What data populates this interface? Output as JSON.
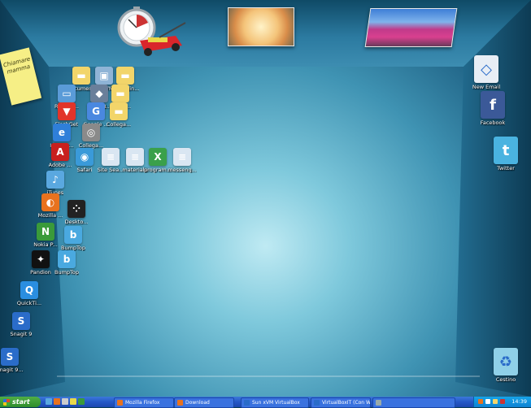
{
  "note": {
    "text": "Chiamare mamma"
  },
  "desktop_icons": [
    {
      "id": "documenti",
      "label": "Documenti",
      "icon": "folder-icon",
      "color": "#f2d56a"
    },
    {
      "id": "sugarvm",
      "label": "SugarVM...",
      "icon": "vm-icon",
      "color": "#8fb4d6"
    },
    {
      "id": "immagini",
      "label": "Immagin...",
      "icon": "folder-icon",
      "color": "#f2d56a"
    },
    {
      "id": "risorse",
      "label": "Risorse...",
      "icon": "computer-icon",
      "color": "#5a9bd8"
    },
    {
      "id": "freedb",
      "label": "FreeDB...",
      "icon": "app-icon",
      "color": "#6a7f9a"
    },
    {
      "id": "collegamento1",
      "label": "Colleg...",
      "icon": "folder-icon",
      "color": "#f2d56a"
    },
    {
      "id": "flashget",
      "label": "FlashGet",
      "icon": "flashget-icon",
      "color": "#e2342a"
    },
    {
      "id": "google",
      "label": "Google ...",
      "icon": "google-icon",
      "color": "#4a88e0"
    },
    {
      "id": "collegamento2",
      "label": "Collega...",
      "icon": "folder-icon",
      "color": "#f2d56a"
    },
    {
      "id": "internet",
      "label": "Interne...",
      "icon": "internet-explorer-icon",
      "color": "#2f7fd9"
    },
    {
      "id": "collegamento3",
      "label": "Collega...",
      "icon": "shortcut-icon",
      "color": "#8a8a8a"
    },
    {
      "id": "adobe",
      "label": "Adobe ...",
      "icon": "adobe-reader-icon",
      "color": "#c8201e"
    },
    {
      "id": "safari",
      "label": "Safari",
      "icon": "safari-icon",
      "color": "#3a9ad9"
    },
    {
      "id": "siteseal",
      "label": "Site Sea...",
      "icon": "document-icon",
      "color": "#d9e6f2"
    },
    {
      "id": "materiale",
      "label": "materiale",
      "icon": "document-icon",
      "color": "#d9e6f2"
    },
    {
      "id": "programma",
      "label": "program...",
      "icon": "excel-icon",
      "color": "#3aa04a"
    },
    {
      "id": "messenger",
      "label": "messeng...",
      "icon": "document-icon",
      "color": "#d9e6f2"
    },
    {
      "id": "itunes",
      "label": "iTunes",
      "icon": "itunes-icon",
      "color": "#5aa8e0"
    },
    {
      "id": "mozilla",
      "label": "Mozilla ...",
      "icon": "firefox-icon",
      "color": "#e8721e"
    },
    {
      "id": "desktop",
      "label": "Deskto...",
      "icon": "blackberry-icon",
      "color": "#222"
    },
    {
      "id": "nokia",
      "label": "Nokia P...",
      "icon": "nokia-icon",
      "color": "#3a9a3a"
    },
    {
      "id": "bumptop1",
      "label": "BumpTop",
      "icon": "bumptop-icon",
      "color": "#4aa9e0"
    },
    {
      "id": "pandion",
      "label": "Pandion",
      "icon": "pandion-icon",
      "color": "#111"
    },
    {
      "id": "bumptop2",
      "label": "BumpTop",
      "icon": "bumptop-icon",
      "color": "#4aa9e0"
    },
    {
      "id": "quicktime",
      "label": "QuickTi...",
      "icon": "quicktime-icon",
      "color": "#2a8ee0"
    },
    {
      "id": "snagit1",
      "label": "Snagit 9",
      "icon": "snagit-icon",
      "color": "#2a6cc9"
    },
    {
      "id": "snagit2",
      "label": "Snagit 9...",
      "icon": "snagit-icon",
      "color": "#2a6cc9"
    }
  ],
  "right_icons": [
    {
      "id": "newemail",
      "label": "New Email",
      "icon": "email-icon",
      "color": "#e8eef5"
    },
    {
      "id": "facebook",
      "label": "Facebook",
      "icon": "facebook-icon",
      "color": "#3b5998",
      "glyph": "f"
    },
    {
      "id": "twitter",
      "label": "Twitter",
      "icon": "twitter-icon",
      "color": "#4ab3e0",
      "glyph": "t"
    },
    {
      "id": "cestino",
      "label": "Cestino",
      "icon": "recycle-bin-icon",
      "color": "#8fd0e8"
    }
  ],
  "taskbar": {
    "start_label": "start",
    "tasks": [
      {
        "label": "Mozilla Firefox",
        "icon": "firefox-icon",
        "color": "#e8721e"
      },
      {
        "label": "Download",
        "icon": "download-icon",
        "color": "#e8721e"
      },
      {
        "label": "Sun xVM VirtualBox",
        "icon": "virtualbox-icon",
        "color": "#2a6cc9"
      },
      {
        "label": "VirtualBoxIT (Con Wa...",
        "icon": "virtualbox-icon",
        "color": "#2a6cc9"
      },
      {
        "label": "",
        "icon": "app-icon",
        "color": "#9aa"
      }
    ],
    "clock": "14:39"
  }
}
